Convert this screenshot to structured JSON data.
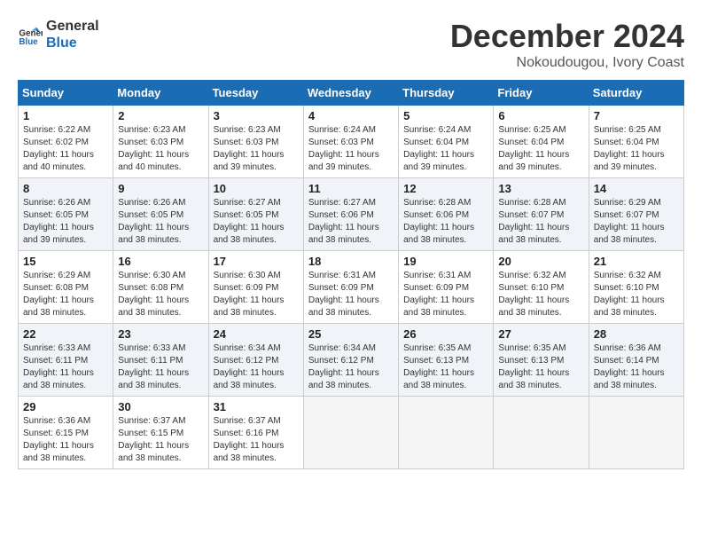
{
  "logo": {
    "line1": "General",
    "line2": "Blue"
  },
  "title": "December 2024",
  "subtitle": "Nokoudougou, Ivory Coast",
  "days_header": [
    "Sunday",
    "Monday",
    "Tuesday",
    "Wednesday",
    "Thursday",
    "Friday",
    "Saturday"
  ],
  "weeks": [
    [
      {
        "day": "1",
        "info": "Sunrise: 6:22 AM\nSunset: 6:02 PM\nDaylight: 11 hours\nand 40 minutes."
      },
      {
        "day": "2",
        "info": "Sunrise: 6:23 AM\nSunset: 6:03 PM\nDaylight: 11 hours\nand 40 minutes."
      },
      {
        "day": "3",
        "info": "Sunrise: 6:23 AM\nSunset: 6:03 PM\nDaylight: 11 hours\nand 39 minutes."
      },
      {
        "day": "4",
        "info": "Sunrise: 6:24 AM\nSunset: 6:03 PM\nDaylight: 11 hours\nand 39 minutes."
      },
      {
        "day": "5",
        "info": "Sunrise: 6:24 AM\nSunset: 6:04 PM\nDaylight: 11 hours\nand 39 minutes."
      },
      {
        "day": "6",
        "info": "Sunrise: 6:25 AM\nSunset: 6:04 PM\nDaylight: 11 hours\nand 39 minutes."
      },
      {
        "day": "7",
        "info": "Sunrise: 6:25 AM\nSunset: 6:04 PM\nDaylight: 11 hours\nand 39 minutes."
      }
    ],
    [
      {
        "day": "8",
        "info": "Sunrise: 6:26 AM\nSunset: 6:05 PM\nDaylight: 11 hours\nand 39 minutes."
      },
      {
        "day": "9",
        "info": "Sunrise: 6:26 AM\nSunset: 6:05 PM\nDaylight: 11 hours\nand 38 minutes."
      },
      {
        "day": "10",
        "info": "Sunrise: 6:27 AM\nSunset: 6:05 PM\nDaylight: 11 hours\nand 38 minutes."
      },
      {
        "day": "11",
        "info": "Sunrise: 6:27 AM\nSunset: 6:06 PM\nDaylight: 11 hours\nand 38 minutes."
      },
      {
        "day": "12",
        "info": "Sunrise: 6:28 AM\nSunset: 6:06 PM\nDaylight: 11 hours\nand 38 minutes."
      },
      {
        "day": "13",
        "info": "Sunrise: 6:28 AM\nSunset: 6:07 PM\nDaylight: 11 hours\nand 38 minutes."
      },
      {
        "day": "14",
        "info": "Sunrise: 6:29 AM\nSunset: 6:07 PM\nDaylight: 11 hours\nand 38 minutes."
      }
    ],
    [
      {
        "day": "15",
        "info": "Sunrise: 6:29 AM\nSunset: 6:08 PM\nDaylight: 11 hours\nand 38 minutes."
      },
      {
        "day": "16",
        "info": "Sunrise: 6:30 AM\nSunset: 6:08 PM\nDaylight: 11 hours\nand 38 minutes."
      },
      {
        "day": "17",
        "info": "Sunrise: 6:30 AM\nSunset: 6:09 PM\nDaylight: 11 hours\nand 38 minutes."
      },
      {
        "day": "18",
        "info": "Sunrise: 6:31 AM\nSunset: 6:09 PM\nDaylight: 11 hours\nand 38 minutes."
      },
      {
        "day": "19",
        "info": "Sunrise: 6:31 AM\nSunset: 6:09 PM\nDaylight: 11 hours\nand 38 minutes."
      },
      {
        "day": "20",
        "info": "Sunrise: 6:32 AM\nSunset: 6:10 PM\nDaylight: 11 hours\nand 38 minutes."
      },
      {
        "day": "21",
        "info": "Sunrise: 6:32 AM\nSunset: 6:10 PM\nDaylight: 11 hours\nand 38 minutes."
      }
    ],
    [
      {
        "day": "22",
        "info": "Sunrise: 6:33 AM\nSunset: 6:11 PM\nDaylight: 11 hours\nand 38 minutes."
      },
      {
        "day": "23",
        "info": "Sunrise: 6:33 AM\nSunset: 6:11 PM\nDaylight: 11 hours\nand 38 minutes."
      },
      {
        "day": "24",
        "info": "Sunrise: 6:34 AM\nSunset: 6:12 PM\nDaylight: 11 hours\nand 38 minutes."
      },
      {
        "day": "25",
        "info": "Sunrise: 6:34 AM\nSunset: 6:12 PM\nDaylight: 11 hours\nand 38 minutes."
      },
      {
        "day": "26",
        "info": "Sunrise: 6:35 AM\nSunset: 6:13 PM\nDaylight: 11 hours\nand 38 minutes."
      },
      {
        "day": "27",
        "info": "Sunrise: 6:35 AM\nSunset: 6:13 PM\nDaylight: 11 hours\nand 38 minutes."
      },
      {
        "day": "28",
        "info": "Sunrise: 6:36 AM\nSunset: 6:14 PM\nDaylight: 11 hours\nand 38 minutes."
      }
    ],
    [
      {
        "day": "29",
        "info": "Sunrise: 6:36 AM\nSunset: 6:15 PM\nDaylight: 11 hours\nand 38 minutes."
      },
      {
        "day": "30",
        "info": "Sunrise: 6:37 AM\nSunset: 6:15 PM\nDaylight: 11 hours\nand 38 minutes."
      },
      {
        "day": "31",
        "info": "Sunrise: 6:37 AM\nSunset: 6:16 PM\nDaylight: 11 hours\nand 38 minutes."
      },
      {
        "day": "",
        "info": ""
      },
      {
        "day": "",
        "info": ""
      },
      {
        "day": "",
        "info": ""
      },
      {
        "day": "",
        "info": ""
      }
    ]
  ]
}
